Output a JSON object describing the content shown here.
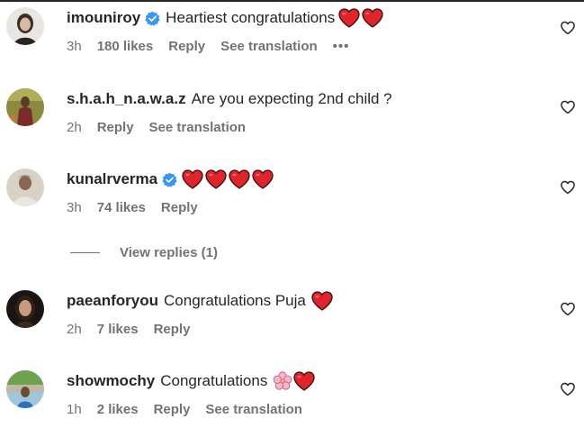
{
  "colors": {
    "text": "#262626",
    "secondary": "#737373",
    "verified": "#3897f0",
    "heart": "#e0242c"
  },
  "comments": [
    {
      "username": "imouniroy",
      "verified": true,
      "text": "Heartiest congratulations",
      "emojis": [
        "red-heart",
        "red-heart"
      ],
      "time": "3h",
      "likes": "180 likes",
      "reply": "Reply",
      "translation": "See translation",
      "more": "•••",
      "icon": "heart-outline-icon"
    },
    {
      "username": "s.h.a.h_n.a.w.a.z",
      "verified": false,
      "text": "Are you expecting 2nd child ?",
      "emojis": [],
      "time": "2h",
      "likes": "",
      "reply": "Reply",
      "translation": "See translation",
      "icon": "heart-outline-icon"
    },
    {
      "username": "kunalrverma",
      "verified": true,
      "text": "",
      "emojis": [
        "red-heart",
        "red-heart",
        "red-heart",
        "red-heart"
      ],
      "time": "3h",
      "likes": "74 likes",
      "reply": "Reply",
      "translation": "",
      "icon": "heart-outline-icon"
    },
    {
      "username": "paeanforyou",
      "verified": false,
      "text": "Congratulations Puja",
      "emojis": [
        "red-heart"
      ],
      "time": "2h",
      "likes": "7 likes",
      "reply": "Reply",
      "translation": "",
      "icon": "heart-outline-icon"
    },
    {
      "username": "showmochy",
      "verified": false,
      "text": "Congratulations",
      "emojis": [
        "cherry-blossom",
        "red-heart"
      ],
      "time": "1h",
      "likes": "2 likes",
      "reply": "Reply",
      "translation": "See translation",
      "icon": "heart-outline-icon"
    }
  ],
  "view_replies": "View replies (1)"
}
